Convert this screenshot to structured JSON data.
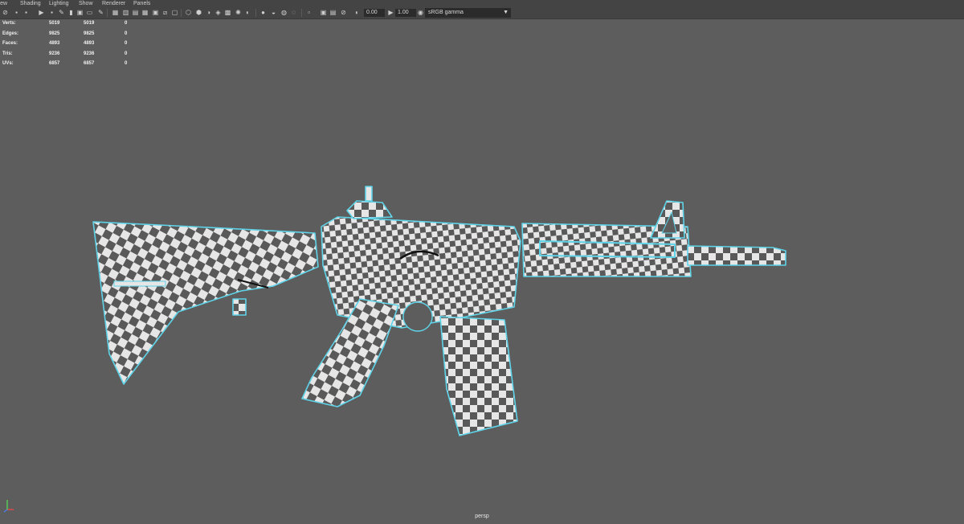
{
  "menubar": {
    "items": [
      "View",
      "Shading",
      "Lighting",
      "Show",
      "Renderer",
      "Panels"
    ]
  },
  "toolbar": {
    "exposure_value": "0.00",
    "gamma_value": "1.00",
    "color_space": "sRGB gamma",
    "icons": [
      "camera-select-icon",
      "camera-attributes-icon",
      "bookmark-icon",
      "image-plane-icon",
      "two-d-pan-zoom-icon",
      "grease-pencil-icon",
      "grid-icon",
      "film-gate-icon",
      "resolution-gate-icon",
      "gate-mask-icon",
      "field-chart-icon",
      "safe-action-icon",
      "safe-title-icon",
      "wireframe-icon",
      "smooth-shade-icon",
      "default-material-icon",
      "textured-icon",
      "lights-icon",
      "shadows-icon",
      "screen-space-ao-icon",
      "motion-blur-icon",
      "anti-aliasing-icon",
      "depth-of-field-icon",
      "isolate-select-icon",
      "xray-icon",
      "xray-joints-icon",
      "xray-components-icon",
      "exposure-icon",
      "gamma-icon",
      "color-management-icon"
    ]
  },
  "hud": {
    "rows": [
      {
        "label": "Verts:",
        "v1": "5019",
        "v2": "5019",
        "v3": "0"
      },
      {
        "label": "Edges:",
        "v1": "9825",
        "v2": "9825",
        "v3": "0"
      },
      {
        "label": "Faces:",
        "v1": "4893",
        "v2": "4893",
        "v3": "0"
      },
      {
        "label": "Tris:",
        "v1": "9236",
        "v2": "9236",
        "v3": "0"
      },
      {
        "label": "UVs:",
        "v1": "6857",
        "v2": "6857",
        "v3": "0"
      }
    ]
  },
  "viewport": {
    "camera": "persp",
    "background_color": "#5d5d5d",
    "wire_color": "#5fd3e8",
    "checker_light": "#e6e6e6",
    "checker_dark": "#595959"
  }
}
